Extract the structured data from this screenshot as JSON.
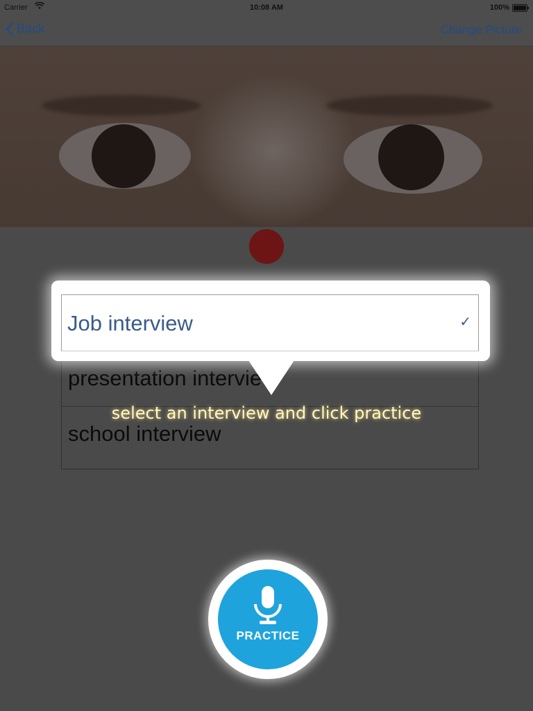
{
  "status_bar": {
    "carrier": "Carrier",
    "time": "10:08 AM",
    "battery": "100%"
  },
  "nav": {
    "back_label": "Back",
    "change_picture_label": "Change Picture"
  },
  "picker": {
    "options": [
      "Job interview",
      "presentation interview",
      "school interview"
    ],
    "selected": "Job interview",
    "check": "✓"
  },
  "tip": "select an interview and click practice",
  "practice_label": "PRACTICE",
  "colors": {
    "accent": "#1fa3dd",
    "link": "#1f4d85",
    "record_dot": "#6d1414",
    "tip_text": "#fff7c8"
  }
}
